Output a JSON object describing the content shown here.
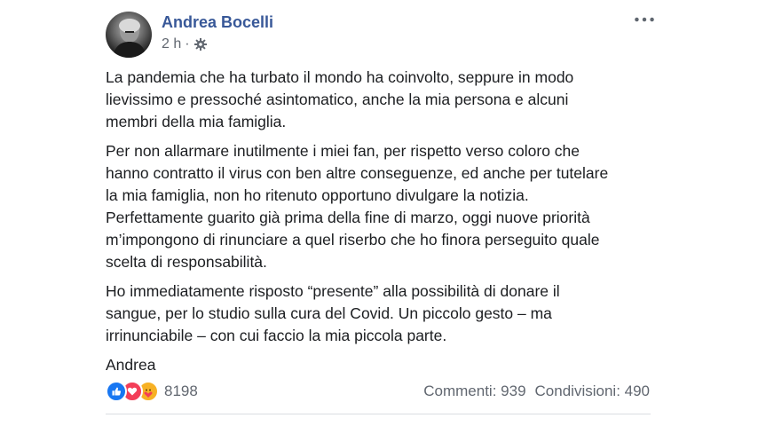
{
  "post": {
    "author": "Andrea Bocelli",
    "time": "2 h",
    "separator": "·",
    "privacy_icon": "gear-icon",
    "more_icon": "more-options-icon",
    "paragraphs": [
      "La pandemia che ha turbato il mondo ha coinvolto, seppure in modo\nlievissimo e pressoché asintomatico, anche la mia persona e alcuni\nmembri della mia famiglia.",
      "Per non allarmare inutilmente i miei fan, per rispetto verso coloro che\nhanno contratto il virus con ben altre conseguenze, ed anche per tutelare\nla mia famiglia, non ho ritenuto opportuno divulgare la notizia.\nPerfettamente guarito già prima della fine di marzo, oggi nuove priorità\nm’impongono di rinunciare a quel riserbo che ho finora perseguito quale\nscelta di responsabilità.",
      "Ho immediatamente risposto “presente” alla possibilità di donare il\nsangue, per lo studio sulla cura del Covid. Un piccolo gesto – ma\nirrinunciabile – con cui faccio la mia piccola parte.",
      "Andrea"
    ]
  },
  "reactions": {
    "icons": [
      "like-icon",
      "love-icon",
      "care-icon"
    ],
    "count": "8198"
  },
  "stats": {
    "comments": "Commenti: 939",
    "shares": "Condivisioni: 490"
  },
  "colors": {
    "author": "#385898",
    "muted": "#616770",
    "like": "#1877f2",
    "love": "#f33e58",
    "care": "#f7b125"
  }
}
